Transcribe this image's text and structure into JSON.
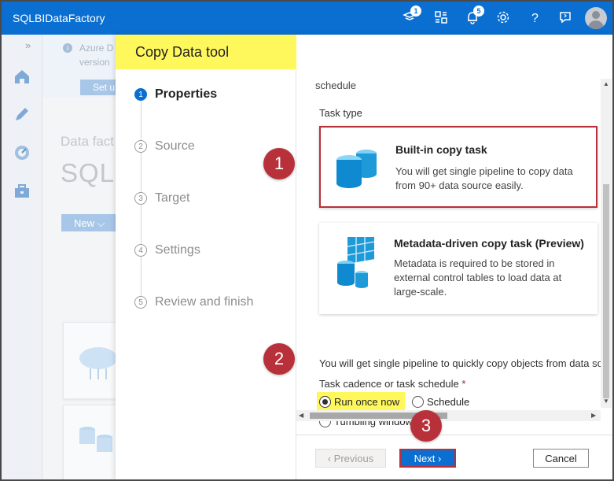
{
  "topbar": {
    "title": "SQLBIDataFactory",
    "icons": [
      {
        "name": "feedback-icon",
        "badge": "1"
      },
      {
        "name": "switch-directory-icon",
        "badge": ""
      },
      {
        "name": "notifications-icon",
        "badge": "5"
      },
      {
        "name": "gear-icon",
        "badge": ""
      },
      {
        "name": "help-icon",
        "badge": ""
      },
      {
        "name": "chat-feedback-icon",
        "badge": ""
      },
      {
        "name": "avatar",
        "badge": ""
      }
    ]
  },
  "rail": {
    "expand": "»",
    "items": [
      "home-icon",
      "pencil-icon",
      "monitor-icon",
      "toolbox-icon"
    ]
  },
  "background": {
    "notice_line1": "Azure D",
    "notice_line2": "version",
    "setup_button": "Set u",
    "df_label": "Data fact",
    "df_name": "SQLE",
    "new_button": "New"
  },
  "wizard": {
    "title": "Copy Data tool",
    "steps": [
      {
        "num": "1",
        "label": "Properties",
        "active": true
      },
      {
        "num": "2",
        "label": "Source",
        "active": false
      },
      {
        "num": "3",
        "label": "Target",
        "active": false
      },
      {
        "num": "4",
        "label": "Settings",
        "active": false
      },
      {
        "num": "5",
        "label": "Review and finish",
        "active": false
      }
    ]
  },
  "content": {
    "schedule_cut": "schedule",
    "task_type_label": "Task type",
    "builtin": {
      "title": "Built-in copy task",
      "desc": "You will get single pipeline to copy data from 90+ data source easily."
    },
    "metadata": {
      "title": "Metadata-driven copy task (Preview)",
      "desc": "Metadata is required to be stored in external control tables to load data at large-scale."
    },
    "cut_text": "You will get single pipeline to quickly copy objects from data so",
    "cadence_label": "Task cadence or task schedule",
    "required_mark": "*",
    "options": {
      "run_once": "Run once now",
      "schedule": "Schedule",
      "tumbling": "Tumbling window"
    }
  },
  "footer": {
    "previous": "‹ Previous",
    "next": "Next ›",
    "cancel": "Cancel"
  },
  "callouts": [
    "1",
    "2",
    "3"
  ],
  "colors": {
    "topbar": "#0a6fd1",
    "highlight": "#fff85c",
    "callout": "#b8313a",
    "primary_button": "#0a6fd1"
  }
}
